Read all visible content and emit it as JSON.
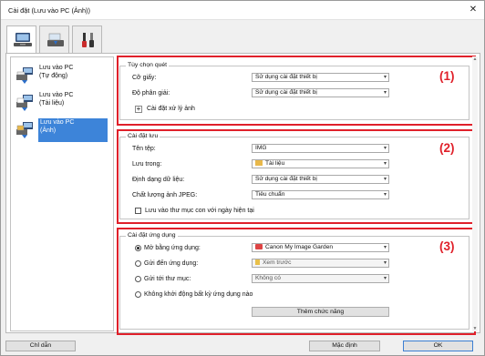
{
  "window": {
    "title": "Cài đặt (Lưu vào PC (Ảnh))",
    "close_glyph": "✕"
  },
  "tabs": [
    {
      "name": "computer-tab",
      "icon": "computer-icon"
    },
    {
      "name": "scanner-tab",
      "icon": "scanner-icon"
    },
    {
      "name": "tools-tab",
      "icon": "tools-icon"
    }
  ],
  "sidebar": {
    "items": [
      {
        "line1": "Lưu vào PC",
        "line2": "(Tự động)",
        "icon": "save-auto-icon",
        "selected": false
      },
      {
        "line1": "Lưu vào PC",
        "line2": "(Tài liệu)",
        "icon": "save-document-icon",
        "selected": false
      },
      {
        "line1": "Lưu vào PC",
        "line2": "(Ảnh)",
        "icon": "save-photo-icon",
        "selected": true
      }
    ]
  },
  "scan_options": {
    "title": "Tùy chọn quét",
    "paper_size_label": "Cỡ giấy:",
    "paper_size_value": "Sử dụng cài đặt thiết bị",
    "resolution_label": "Độ phân giải:",
    "resolution_value": "Sử dụng cài đặt thiết bị",
    "image_processing_label": "Cài đặt xử lý ảnh",
    "number": "(1)"
  },
  "save_settings": {
    "title": "Cài đặt lưu",
    "file_name_label": "Tên tệp:",
    "file_name_value": "IMG",
    "save_in_label": "Lưu trong:",
    "save_in_value": "Tài liệu",
    "data_format_label": "Định dạng dữ liệu:",
    "data_format_value": "Sử dụng cài đặt thiết bị",
    "jpeg_quality_label": "Chất lượng ảnh JPEG:",
    "jpeg_quality_value": "Tiêu chuẩn",
    "subfolder_label": "Lưu vào thư mục con với ngày hiện tại",
    "number": "(2)"
  },
  "app_settings": {
    "title": "Cài đặt ứng dụng",
    "open_with_label": "Mở bằng ứng dụng:",
    "open_with_value": "Canon My Image Garden",
    "send_to_app_label": "Gửi đến ứng dụng:",
    "send_to_app_value": "Xem trước",
    "send_to_folder_label": "Gửi tới thư mục:",
    "send_to_folder_value": "Không có",
    "do_not_start_label": "Không khởi động bất kỳ ứng dụng nào",
    "add_function_label": "Thêm chức năng",
    "number": "(3)"
  },
  "footer": {
    "instructions_label": "Chỉ dẫn",
    "defaults_label": "Mặc định",
    "ok_label": "OK"
  },
  "colors": {
    "highlight_red": "#e0202a",
    "selection_blue": "#3d84d9"
  }
}
